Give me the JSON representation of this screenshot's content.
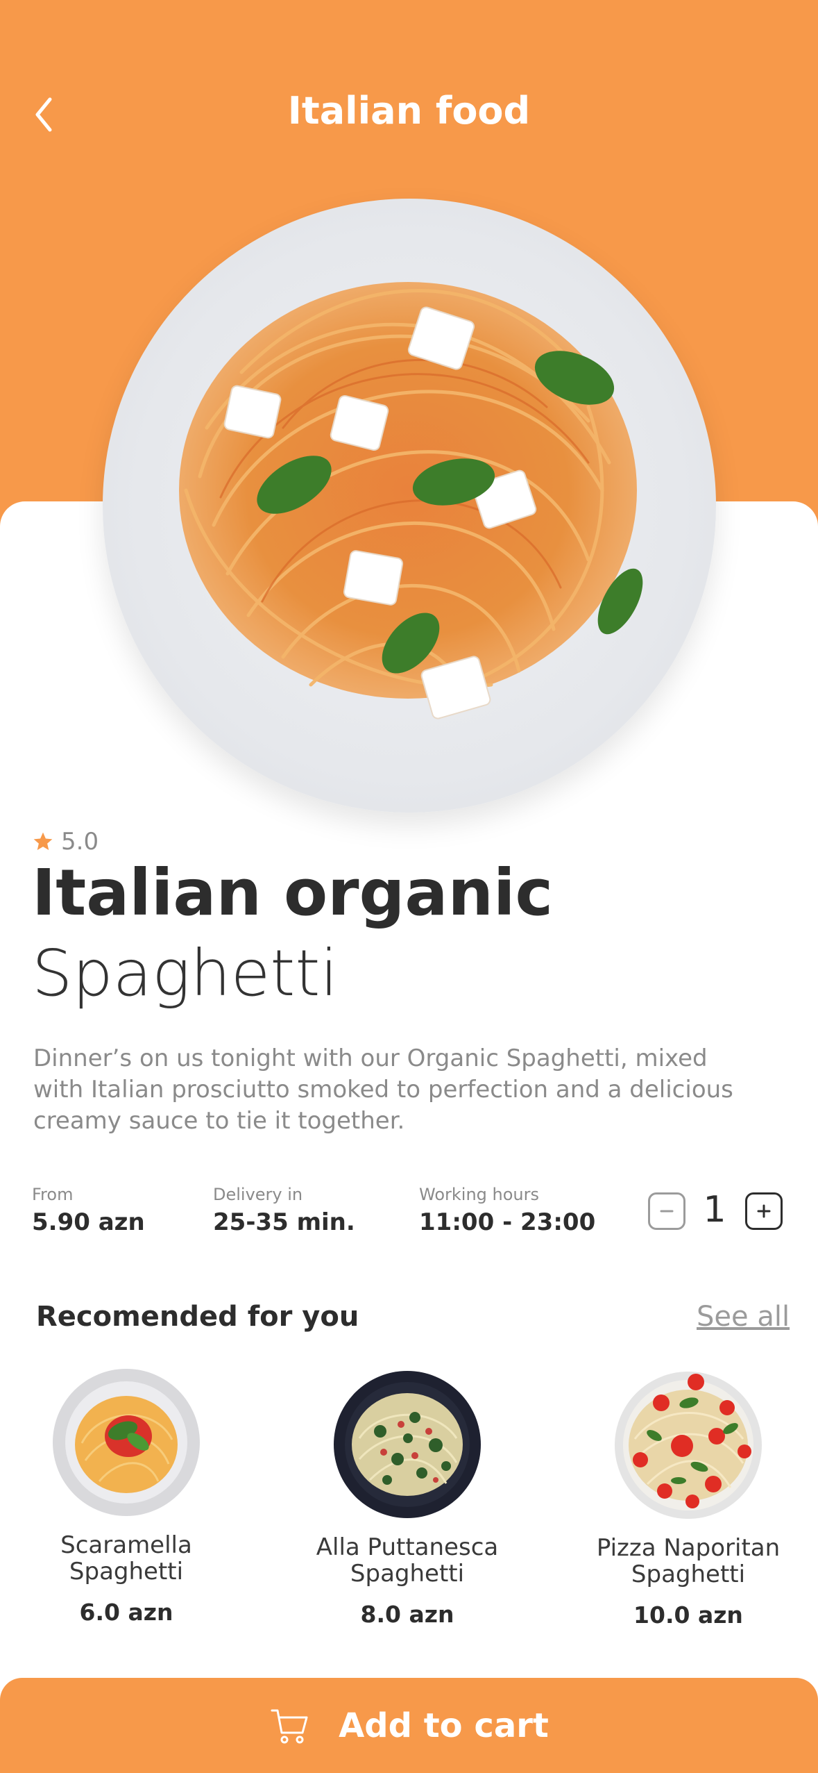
{
  "header": {
    "title": "Italian food",
    "background_color": "#f7994a",
    "back_icon": "chevron-left-icon"
  },
  "product": {
    "rating": "5.0",
    "rating_icon": "star-icon",
    "title_bold": "Italian organic",
    "title_light": "Spaghetti",
    "description": "Dinner’s on us tonight with our Organic Spaghetti, mixed with Italian prosciutto smoked to perfection and a delicious creamy sauce to tie it together.",
    "accent_color": "#f7994a"
  },
  "info": [
    {
      "label": "From",
      "value": "5.90 azn"
    },
    {
      "label": "Delivery in",
      "value": "25-35 min."
    },
    {
      "label": "Working hours",
      "value": "11:00 - 23:00"
    }
  ],
  "quantity": {
    "value": "1",
    "minus_icon": "minus-icon",
    "plus_icon": "plus-icon"
  },
  "recommended": {
    "title": "Recomended for you",
    "see_all": "See all",
    "items": [
      {
        "name_line1": "Scaramella",
        "name_line2": "Spaghetti",
        "price": "6.0 azn"
      },
      {
        "name_line1": "Alla Puttanesca",
        "name_line2": "Spaghetti",
        "price": "8.0 azn"
      },
      {
        "name_line1": "Pizza Naporitan",
        "name_line2": "Spaghetti",
        "price": "10.0 azn"
      }
    ]
  },
  "cart": {
    "label": "Add to cart",
    "icon": "cart-icon"
  }
}
